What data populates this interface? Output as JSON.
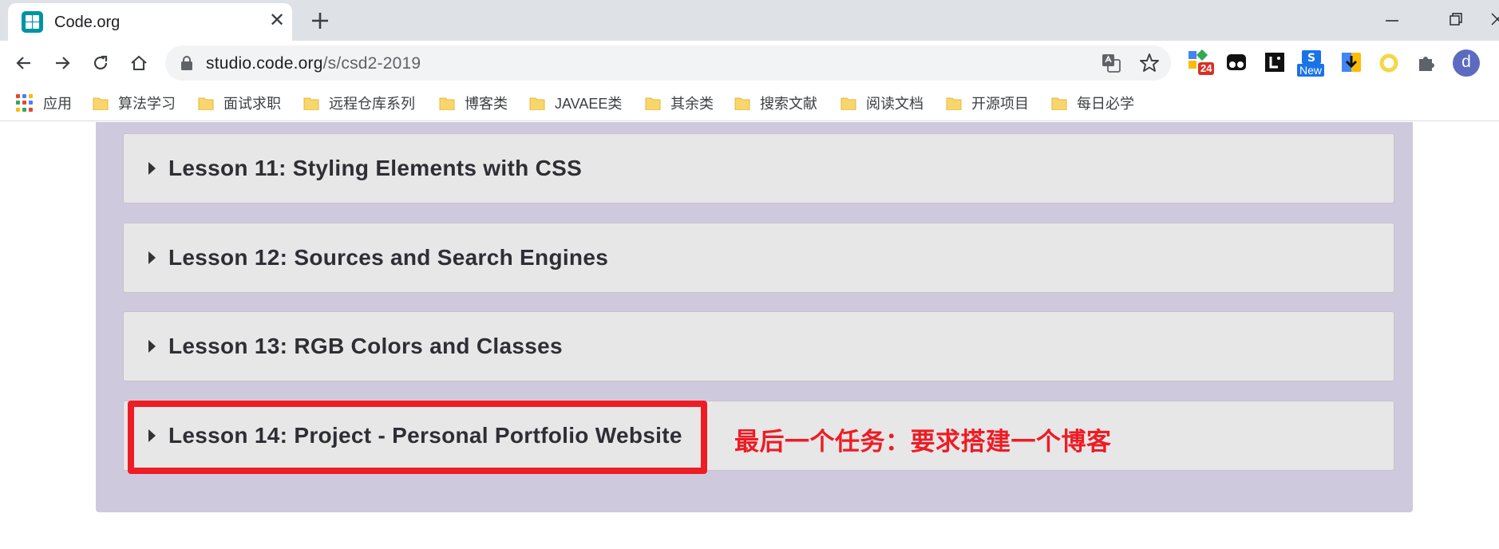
{
  "tab": {
    "title": "Code.org",
    "close_glyph": "✕"
  },
  "window_controls": [
    "minimize",
    "restore",
    "close"
  ],
  "toolbar": {
    "url_host": "studio.code.org",
    "url_path": "/s/csd2-2019",
    "extension_badge": "24",
    "extension_new_label": "New",
    "avatar_letter": "d"
  },
  "bookmarks": {
    "apps_label": "应用",
    "items": [
      "算法学习",
      "面试求职",
      "远程仓库系列",
      "博客类",
      "JAVAEE类",
      "其余类",
      "搜索文献",
      "阅读文档",
      "开源项目",
      "每日必学"
    ]
  },
  "lessons": [
    {
      "title": "Lesson 11: Styling Elements with CSS"
    },
    {
      "title": "Lesson 12: Sources and Search Engines"
    },
    {
      "title": "Lesson 13: RGB Colors and Classes"
    },
    {
      "title": "Lesson 14: Project - Personal Portfolio Website"
    }
  ],
  "annotation": {
    "text": "最后一个任务：要求搭建一个博客"
  },
  "colors": {
    "panel": "#cfc9de",
    "lesson_bg": "#e7e7e8",
    "annotation_red": "#ee1c24",
    "favicon": "#0093a4"
  }
}
